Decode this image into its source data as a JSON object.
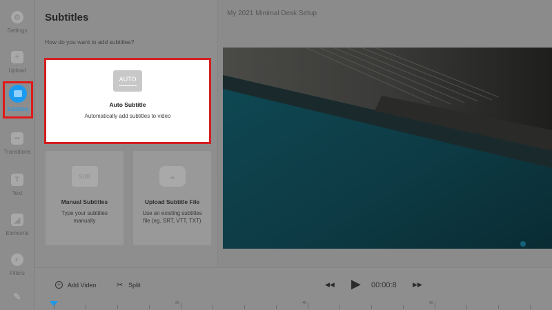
{
  "sidebar": {
    "items": [
      {
        "label": "Settings",
        "icon": "settings-icon"
      },
      {
        "label": "Upload",
        "icon": "upload-icon"
      },
      {
        "label": "Subtitles",
        "icon": "subtitles-icon",
        "active": true
      },
      {
        "label": "Transitions",
        "icon": "transitions-icon"
      },
      {
        "label": "Text",
        "icon": "text-icon"
      },
      {
        "label": "Elements",
        "icon": "elements-icon"
      },
      {
        "label": "Filters",
        "icon": "filters-icon"
      }
    ]
  },
  "panel": {
    "title": "Subtitles",
    "subtitle": "How do you want to add subtitles?",
    "auto": {
      "badge": "AUTO",
      "title": "Auto Subtitle",
      "desc": "Automatically add subtitles to video"
    },
    "manual": {
      "badge": "SUB",
      "title": "Manual Subtitles",
      "desc": "Type your subtitles manually"
    },
    "upload": {
      "title": "Upload Subtitle File",
      "desc": "Use an existing subtitles file (eg. SRT, VTT, TXT)"
    }
  },
  "project": {
    "title": "My 2021 Minimal Desk Setup"
  },
  "toolbar": {
    "add_video": "Add Video",
    "split": "Split",
    "timecode": "00:00:8"
  },
  "timeline": {
    "labels": [
      "20",
      "40",
      "60"
    ]
  },
  "colors": {
    "accent": "#1a9bf0",
    "highlight": "#d41f1f"
  }
}
